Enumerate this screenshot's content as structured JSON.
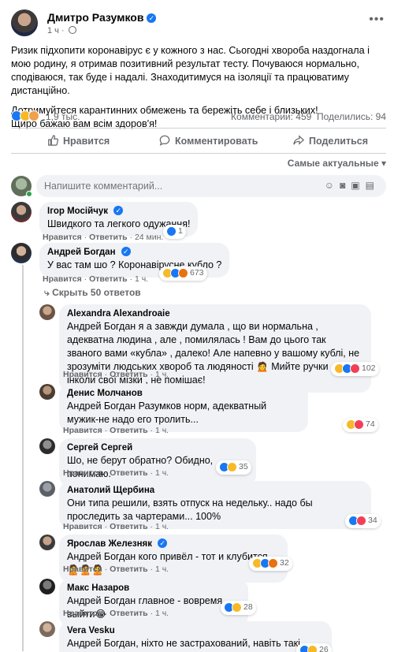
{
  "post": {
    "author": "Дмитро Разумков",
    "time": "1 ч",
    "paragraph1": "Ризик підхопити коронавірус є у кожного з нас. Сьогодні хвороба наздогнала і мою родину, я отримав позитивний результат тесту. Почуваюся нормально, сподіваюся, так буде і надалі. Знаходитимуся на ізоляції та працюватиму дистанційно.",
    "paragraph2_line1": "Дотримуйтеся карантинних обмежень та бережіть себе і близьких!",
    "paragraph2_line2": "Щиро бажаю вам всім здоров'я!",
    "reactions_count": "1,9 тыс.",
    "comments_count": "Комментарии: 459",
    "shares_count": "Поделились: 94"
  },
  "actions": {
    "like": "Нравится",
    "comment": "Комментировать",
    "share": "Поделиться"
  },
  "sort_label": "Самые актуальные",
  "composer": {
    "placeholder": "Напишите комментарий..."
  },
  "comment_actions": {
    "like": "Нравится",
    "reply": "Ответить"
  },
  "hide_replies": "Скрыть 50 ответов",
  "comments": [
    {
      "name": "Ігор Мосійчук",
      "text": "Швидкого та легкого одужання!",
      "time": "24 мин.",
      "reactions": "1"
    },
    {
      "name": "Андрей Богдан",
      "text": "У вас там шо ? Коронавірусне кубло ?",
      "time": "1 ч.",
      "reactions": "673"
    }
  ],
  "replies": [
    {
      "name": "Alexandra Alexandroaie",
      "text": "Андрей Богдан я а завжди думала , що ви нормальна , адекватна людина , але , помилялась ! Вам до цього так званого вами «кубла» , далеко! Але напевно у вашому кублі, не зрозуміти людських хвороб та людяності 🙍 Мийте ручки , та інколи свої мізки , не помішає!",
      "time": "1 ч.",
      "reactions": "102"
    },
    {
      "name": "Денис Молчанов",
      "text": "Андрей Богдан Разумков норм, адекватный мужик-не надо его тролить...",
      "time": "1 ч.",
      "reactions": "74"
    },
    {
      "name": "Сергей Сергей",
      "text": "Шо, не берут обратно? Обидно, понимаю.",
      "time": "1 ч.",
      "reactions": "35"
    },
    {
      "name": "Анатолий Щербина",
      "text": "Они типа решили, взять отпуск на недельку.. надо бы проследить за чартерами... 100%",
      "time": "1 ч.",
      "reactions": "34"
    },
    {
      "name": "Ярослав Железняк",
      "text": "Андрей Богдан кого привёл - тот и клубится 🙎🙎🙎",
      "time": "1 ч.",
      "reactions": "32"
    },
    {
      "name": "Макс Назаров",
      "text": "Андрей Богдан главное - вовремя выйти😂",
      "time": "1 ч.",
      "reactions": "28"
    },
    {
      "name": "Vera Vesku",
      "text": "Андрей Богдан, ніхто не застрахований, навіть такі герої як ти.",
      "time": "",
      "reactions": "26"
    }
  ],
  "colors": {
    "facebook_blue": "#1877f2",
    "bubble_bg": "#f0f2f5",
    "secondary_text": "#65676b"
  }
}
